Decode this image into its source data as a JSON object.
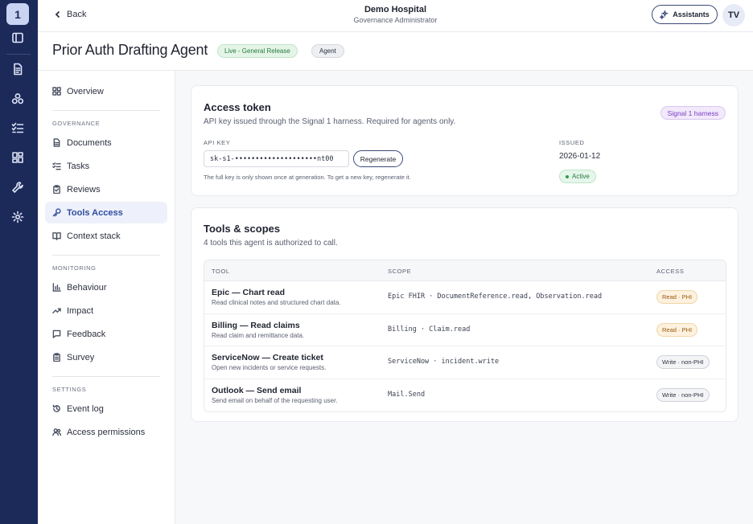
{
  "rail": {
    "logo": "1",
    "icons": [
      "sidebar-toggle-icon",
      "document-icon",
      "agents-icon",
      "tasks-icon",
      "dashboard-icon",
      "wrench-icon",
      "settings-icon"
    ]
  },
  "topbar": {
    "back_label": "Back",
    "org_name": "Demo Hospital",
    "org_role": "Governance Administrator",
    "assistants_label": "Assistants",
    "avatar_initials": "TV"
  },
  "header": {
    "title": "Prior Auth Drafting Agent",
    "status_badge": "Live - General Release",
    "type_badge": "Agent"
  },
  "sidebar": {
    "overview": "Overview",
    "sections": {
      "governance": "GOVERNANCE",
      "monitoring": "MONITORING",
      "settings": "SETTINGS"
    },
    "governance_items": [
      "Documents",
      "Tasks",
      "Reviews",
      "Tools Access",
      "Context stack"
    ],
    "monitoring_items": [
      "Behaviour",
      "Impact",
      "Feedback",
      "Survey"
    ],
    "settings_items": [
      "Event log",
      "Access permissions"
    ],
    "active_item": "Tools Access"
  },
  "access_token": {
    "title": "Access token",
    "subtitle": "API key issued through the Signal 1 harness. Required for agents only.",
    "harness_badge": "Signal 1 harness",
    "api_key_label": "API KEY",
    "api_key_value": "sk-s1-••••••••••••••••••••nt00",
    "regenerate_label": "Regenerate",
    "note": "The full key is only shown once at generation. To get a new key, regenerate it.",
    "issued_label": "ISSUED",
    "issued_date": "2026-01-12",
    "status": "Active"
  },
  "tools": {
    "title": "Tools & scopes",
    "subtitle": "4 tools this agent is authorized to call.",
    "columns": {
      "tool": "TOOL",
      "scope": "SCOPE",
      "access": "ACCESS"
    },
    "rows": [
      {
        "name": "Epic — Chart read",
        "desc": "Read clinical notes and structured chart data.",
        "scope": "Epic FHIR · DocumentReference.read, Observation.read",
        "access": "Read · PHI"
      },
      {
        "name": "Billing — Read claims",
        "desc": "Read claim and remittance data.",
        "scope": "Billing · Claim.read",
        "access": "Read · PHI"
      },
      {
        "name": "ServiceNow — Create ticket",
        "desc": "Open new incidents or service requests.",
        "scope": "ServiceNow · incident.write",
        "access": "Write · non-PHI"
      },
      {
        "name": "Outlook — Send email",
        "desc": "Send email on behalf of the requesting user.",
        "scope": "Mail.Send",
        "access": "Write · non-PHI"
      }
    ]
  },
  "colors": {
    "rail_bg": "#1c2a5a",
    "accent": "#2f4d9e",
    "success": "#267a3c",
    "warning": "#9a5a0c",
    "harness": "#7a3cc2"
  }
}
